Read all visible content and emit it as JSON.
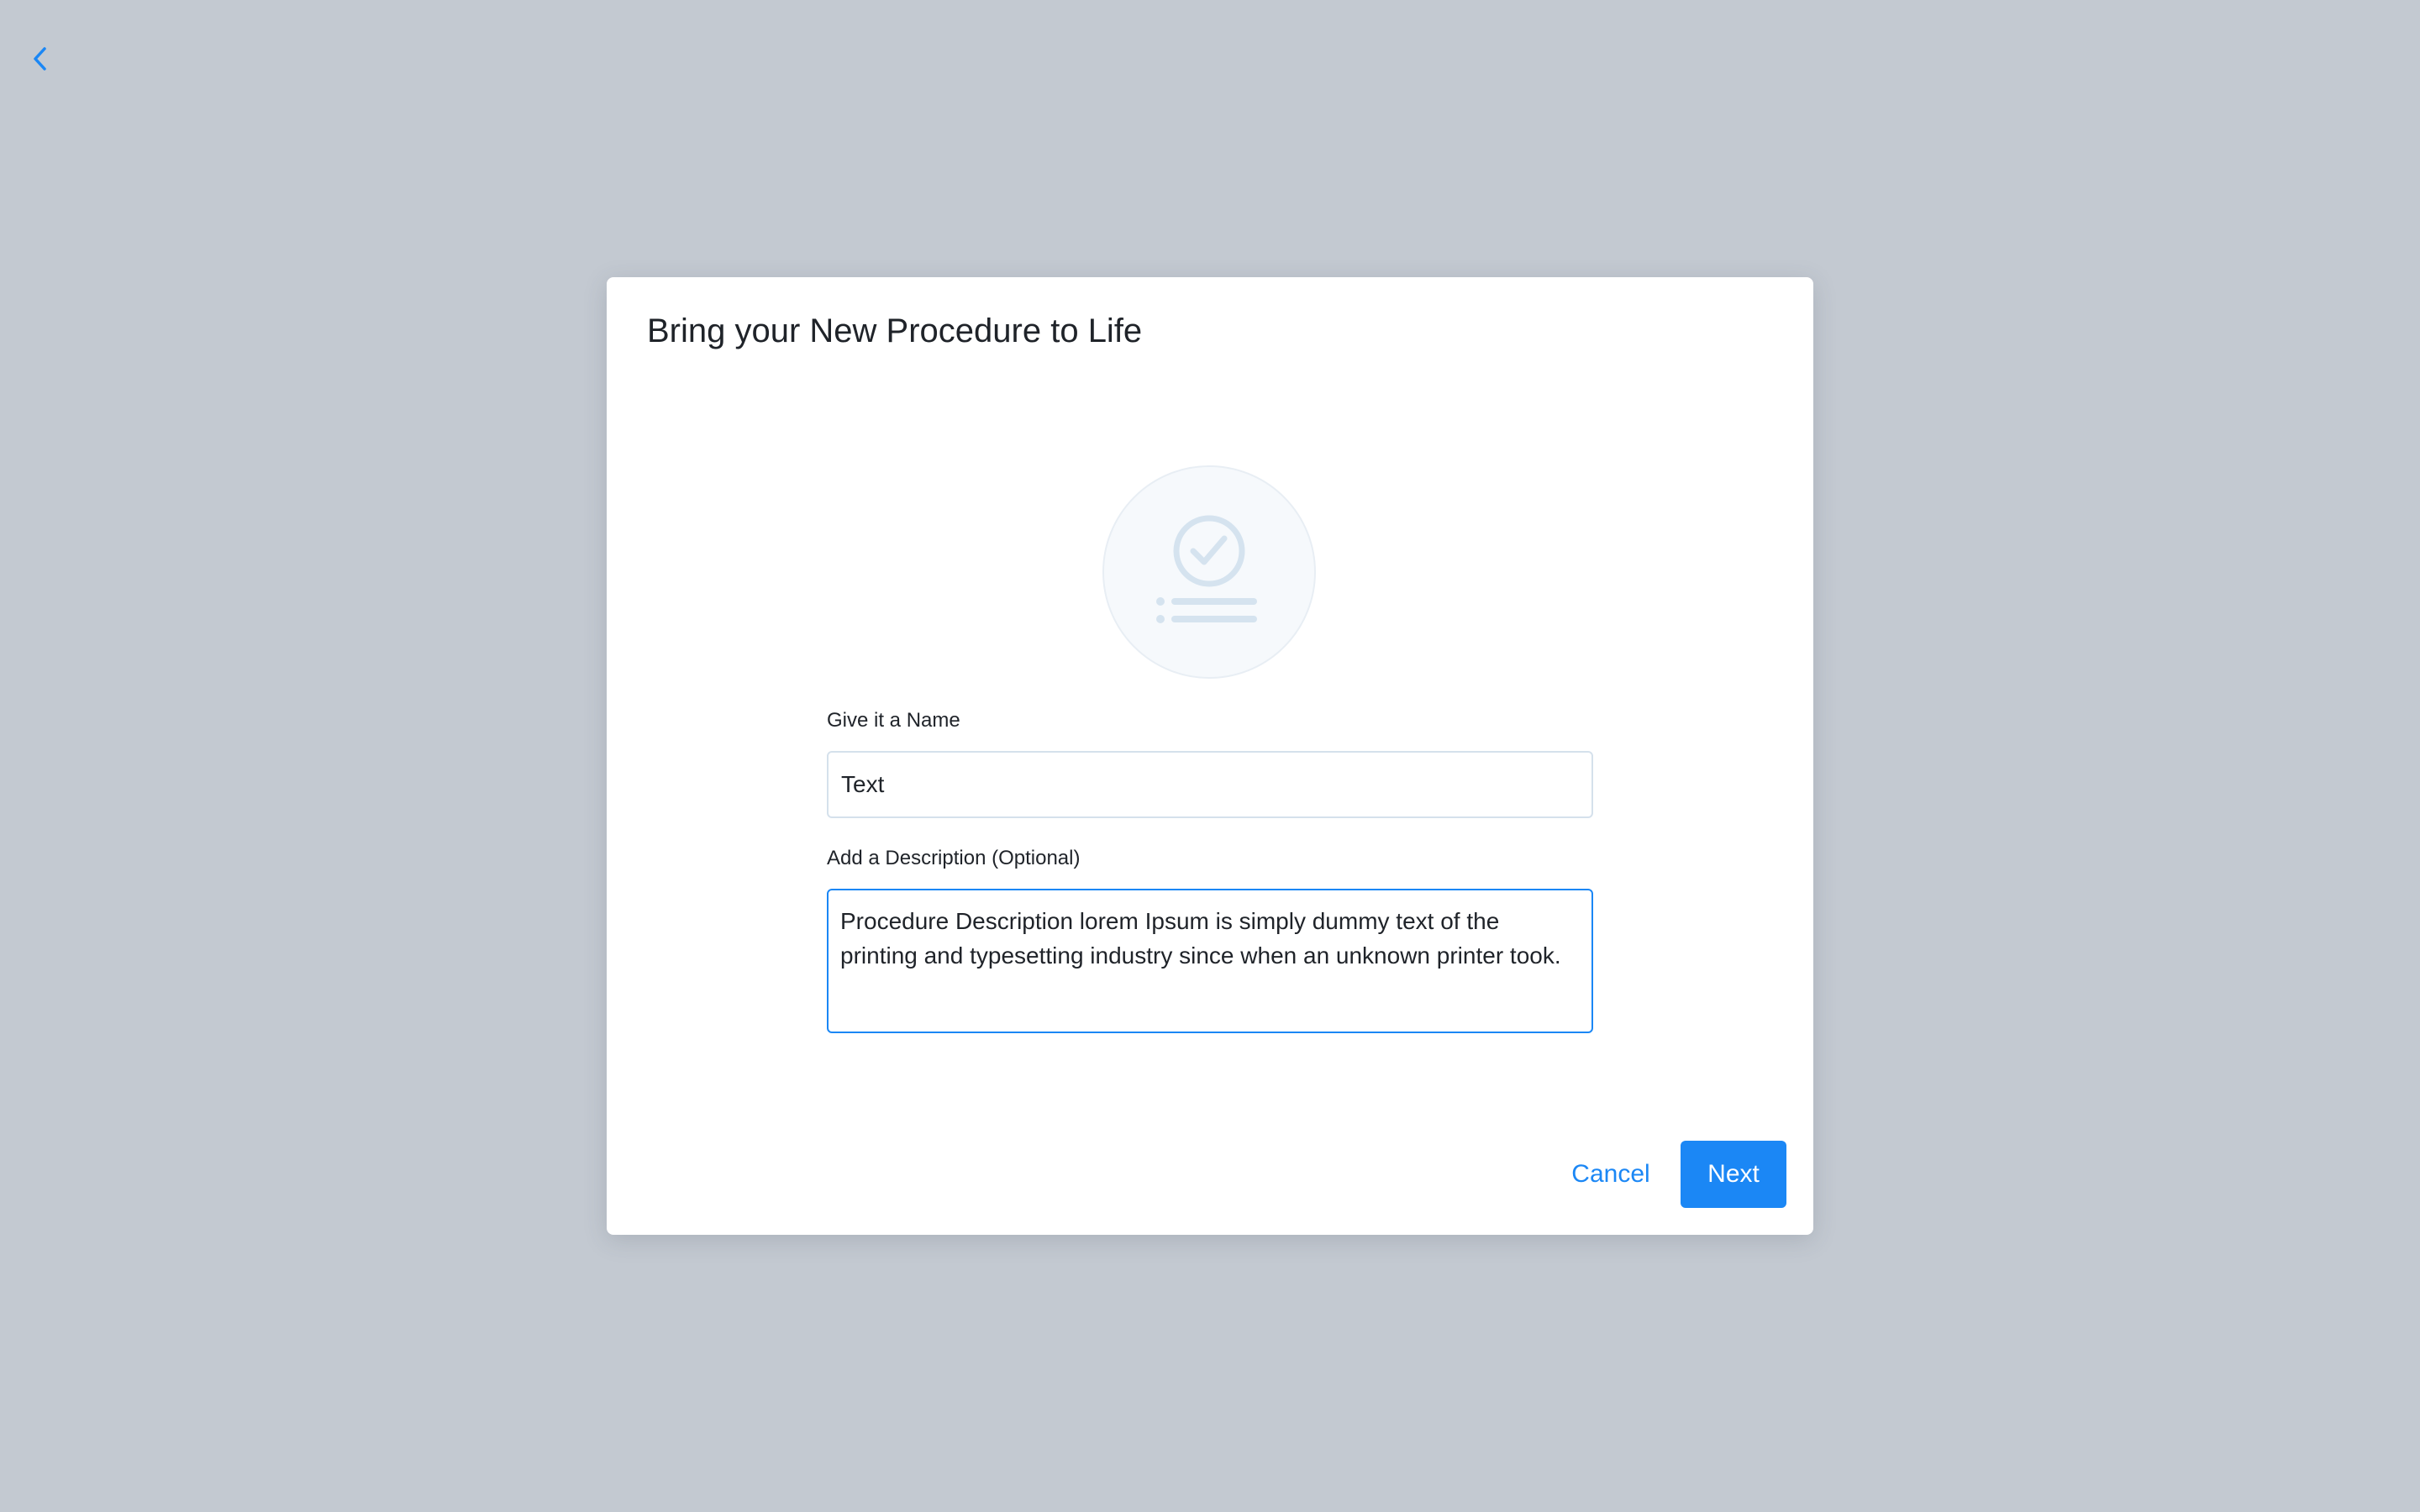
{
  "nav": {
    "back_icon": "chevron-left-icon"
  },
  "modal": {
    "title": "Bring your New Procedure to Life",
    "illustration_icon": "procedure-checklist-icon",
    "name_field": {
      "label": "Give it a Name",
      "value": "Text"
    },
    "description_field": {
      "label": "Add a Description (Optional)",
      "value": "Procedure Description lorem Ipsum is simply dummy text of the printing and typesetting industry since when an unknown printer took."
    },
    "cancel_label": "Cancel",
    "next_label": "Next"
  },
  "colors": {
    "background": "#c3c9d1",
    "accent": "#1b87f5",
    "illustration": "#d5e3ef"
  }
}
